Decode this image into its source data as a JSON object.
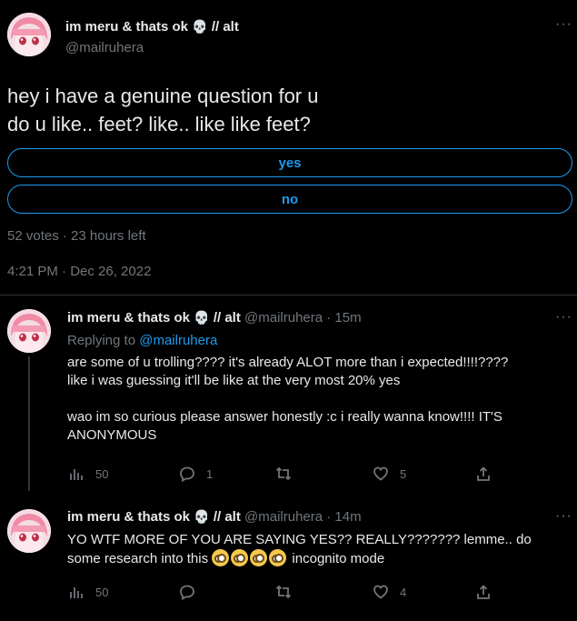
{
  "colors": {
    "accent": "#1d9bf0",
    "muted": "#71767b",
    "text": "#e7e9ea",
    "background": "#000000"
  },
  "main_tweet": {
    "display_name": "im meru & thats ok",
    "name_emoji": "💀",
    "name_suffix": "// alt",
    "handle": "@mailruhera",
    "text_line1": "hey i have a genuine question for u",
    "text_line2": "do u like.. feet? like.. like like feet?",
    "poll": {
      "options": [
        "yes",
        "no"
      ],
      "summary": "52 votes · 23 hours left"
    },
    "timestamp": "4:21 PM · Dec 26, 2022",
    "more_icon": "more-horizontal-icon"
  },
  "replies": [
    {
      "display_name": "im meru & thats ok",
      "name_emoji": "💀",
      "name_suffix": "// alt",
      "handle": "@mailruhera",
      "time": "· 15m",
      "replying_prefix": "Replying to",
      "replying_to": "@mailruhera",
      "lines": [
        "are some of u trolling???? it's already ALOT more than i expected!!!!????",
        "like i was guessing it'll be like at the very most 20% yes",
        "",
        "wao im so curious please answer honestly :c i really wanna know!!!! IT'S",
        "ANONYMOUS"
      ],
      "actions": {
        "views": "50",
        "replies": "1",
        "retweets": "",
        "likes": "5"
      }
    },
    {
      "display_name": "im meru & thats ok",
      "name_emoji": "💀",
      "name_suffix": "// alt",
      "handle": "@mailruhera",
      "time": "· 14m",
      "line1": "YO WTF MORE OF YOU ARE SAYING YES?? REALLY??????? lemme.. do",
      "line2_start": "some research into this",
      "line2_end": "incognito mode",
      "actions": {
        "views": "50",
        "replies": "",
        "retweets": "",
        "likes": "4"
      }
    }
  ]
}
